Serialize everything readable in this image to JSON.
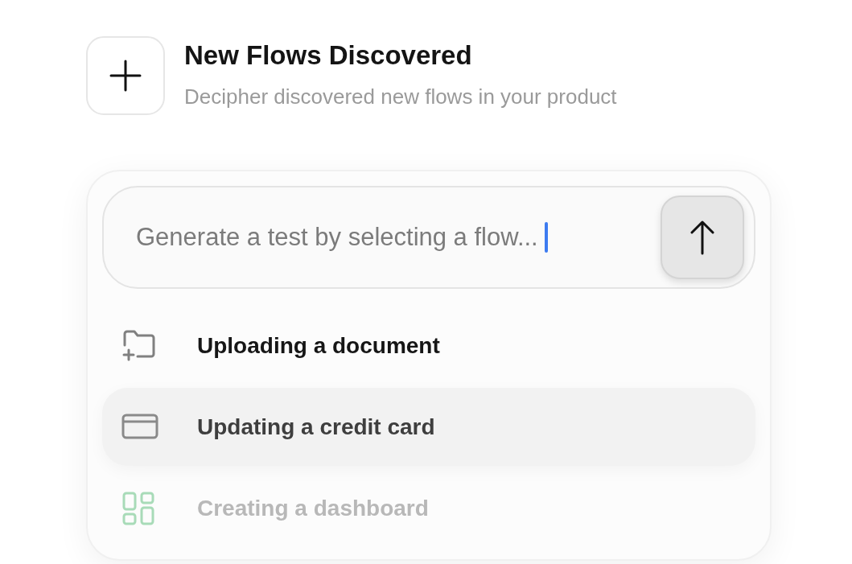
{
  "header": {
    "title": "New Flows Discovered",
    "subtitle": "Decipher discovered new flows in your product"
  },
  "prompt": {
    "placeholder": "Generate a test by selecting a flow..."
  },
  "flows": [
    {
      "kind": "folder",
      "label": "Uploading a document",
      "selected": false,
      "dimmed": false
    },
    {
      "kind": "card",
      "label": "Updating a credit card",
      "selected": true,
      "dimmed": false
    },
    {
      "kind": "grid",
      "label": "Creating a dashboard",
      "selected": false,
      "dimmed": true
    }
  ]
}
